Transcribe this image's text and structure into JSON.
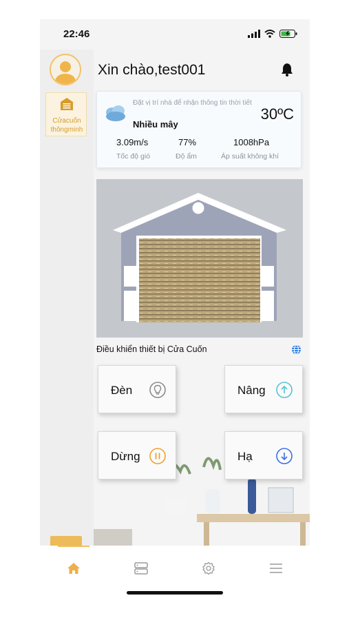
{
  "status_bar": {
    "time": "22:46"
  },
  "sidebar": {
    "device_label": "Cửacuốn thôngminh",
    "add_symbol": "+"
  },
  "header": {
    "greeting": "Xin chào,test001"
  },
  "weather": {
    "hint": "Đặt vị trí nhà để nhận thông tin thời tiết",
    "condition": "Nhiều mây",
    "temperature": "30ºC",
    "metrics": [
      {
        "value": "3.09m/s",
        "label": "Tốc độ gió"
      },
      {
        "value": "77%",
        "label": "Độ ẩm"
      },
      {
        "value": "1008hPa",
        "label": "Áp suất không khí"
      }
    ]
  },
  "control": {
    "title": "Điều khiển thiết bị Cửa Cuốn",
    "buttons": [
      {
        "label": "Đèn",
        "icon": "bulb-icon",
        "color": "#8a8a8a"
      },
      {
        "label": "Nâng",
        "icon": "arrow-up-icon",
        "color": "#55c3d3"
      },
      {
        "label": "Dừng",
        "icon": "pause-icon",
        "color": "#f0a030"
      },
      {
        "label": "Hạ",
        "icon": "arrow-down-icon",
        "color": "#3c6fe0"
      }
    ]
  },
  "nav": {
    "items": [
      "home-icon",
      "devices-icon",
      "settings-icon",
      "menu-icon"
    ],
    "active_color": "#edb04a",
    "inactive_color": "#9a9a9a"
  }
}
